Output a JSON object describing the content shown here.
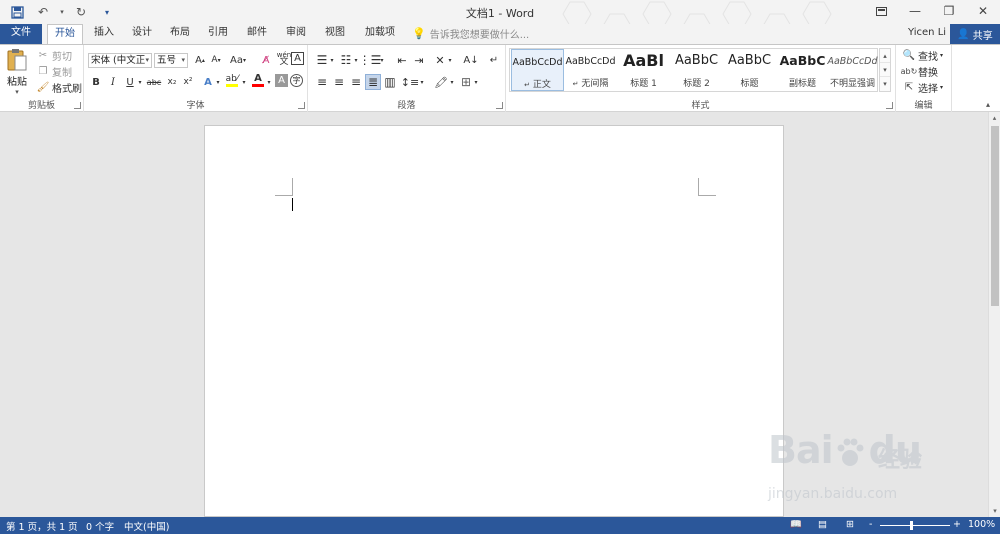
{
  "window": {
    "title": "文档1 - Word"
  },
  "qat": {
    "save_icon": "save-icon",
    "undo_icon": "undo-icon",
    "redo_icon": "redo-icon"
  },
  "tabs": {
    "file": "文件",
    "items": [
      "开始",
      "插入",
      "设计",
      "布局",
      "引用",
      "邮件",
      "审阅",
      "视图",
      "加载项"
    ],
    "active": "开始"
  },
  "tell_me": {
    "placeholder": "告诉我您想要做什么..."
  },
  "account": {
    "user_name": "Yicen Li",
    "share_label": "共享"
  },
  "clipboard": {
    "paste_label": "粘贴",
    "cut_label": "剪切",
    "copy_label": "复制",
    "format_painter_label": "格式刷",
    "group_label": "剪贴板"
  },
  "font": {
    "font_name": "宋体 (中文正",
    "font_size": "五号",
    "change_case_label": "Aa",
    "bold": "B",
    "italic": "I",
    "underline": "U",
    "strikethrough": "abc",
    "subscript": "x₂",
    "superscript": "x²",
    "group_label": "字体"
  },
  "paragraph": {
    "group_label": "段落"
  },
  "styles": {
    "items": [
      {
        "sample": "AaBbCcDd",
        "name": "正文",
        "selected": true
      },
      {
        "sample": "AaBbCcDd",
        "name": "无间隔"
      },
      {
        "sample": "AaBl",
        "name": "标题 1"
      },
      {
        "sample": "AaBbC",
        "name": "标题 2"
      },
      {
        "sample": "AaBbC",
        "name": "标题"
      },
      {
        "sample": "AaBbC",
        "name": "副标题"
      },
      {
        "sample": "AaBbCcDd",
        "name": "不明显强调"
      }
    ],
    "group_label": "样式"
  },
  "editing": {
    "find_label": "查找",
    "replace_label": "替换",
    "select_label": "选择",
    "group_label": "编辑"
  },
  "watermark": {
    "logo": "Bai",
    "logo_tail": "du",
    "cn": "经验",
    "url": "jingyan.baidu.com"
  },
  "status": {
    "page_info": "第 1 页，共 1 页",
    "word_count": "0 个字",
    "language": "中文(中国)",
    "zoom": "100%",
    "zoom_minus": "-",
    "zoom_plus": "+"
  },
  "colors": {
    "accent": "#2b579a",
    "highlight": "#ffff00",
    "font_color": "#ff0000"
  }
}
